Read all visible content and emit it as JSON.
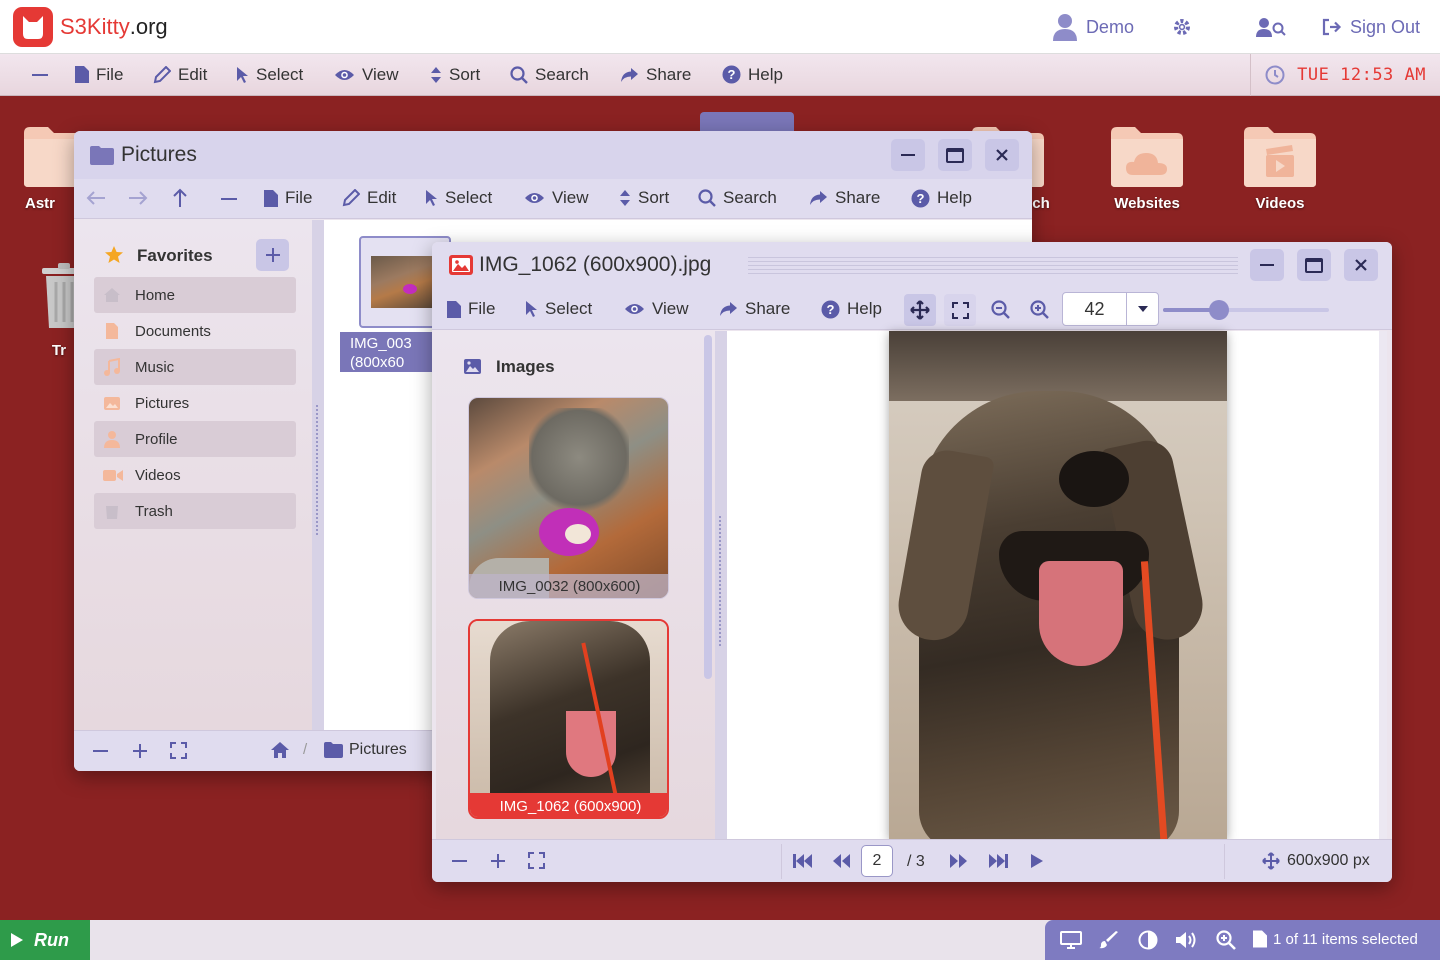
{
  "header": {
    "logo_s3": "S3",
    "logo_kitty": "Kitty",
    "logo_org": ".org",
    "user_label": "Demo",
    "signout_label": "Sign Out"
  },
  "menubar": {
    "items": [
      "File",
      "Edit",
      "Select",
      "View",
      "Sort",
      "Search",
      "Share",
      "Help"
    ],
    "clock": "TUE 12:53 AM"
  },
  "desktop": {
    "icons": [
      {
        "label": "Astr",
        "icon": "folder-icon"
      },
      {
        "label": "Tr",
        "icon": "trash-icon"
      },
      {
        "label": "ch",
        "icon": "folder-icon"
      },
      {
        "label": "Websites",
        "icon": "cloud-folder-icon"
      },
      {
        "label": "Videos",
        "icon": "video-folder-icon"
      }
    ]
  },
  "pictures_window": {
    "title": "Pictures",
    "toolbar": [
      "File",
      "Edit",
      "Select",
      "View",
      "Sort",
      "Search",
      "Share",
      "Help"
    ],
    "favorites_label": "Favorites",
    "sidebar": [
      {
        "label": "Home",
        "icon": "home-icon"
      },
      {
        "label": "Documents",
        "icon": "document-icon"
      },
      {
        "label": "Music",
        "icon": "music-icon"
      },
      {
        "label": "Pictures",
        "icon": "image-icon"
      },
      {
        "label": "Profile",
        "icon": "user-icon"
      },
      {
        "label": "Videos",
        "icon": "video-icon"
      },
      {
        "label": "Trash",
        "icon": "trash-icon"
      }
    ],
    "file_item": {
      "line1": "IMG_003",
      "line2": "(800x60"
    },
    "breadcrumb_folder": "Pictures"
  },
  "viewer_window": {
    "title": "IMG_1062 (600x900).jpg",
    "toolbar": [
      "File",
      "Select",
      "View",
      "Share",
      "Help"
    ],
    "zoom_value": "42",
    "zoom_slider_fraction": 0.34,
    "panel_title": "Images",
    "thumbnails": [
      {
        "label": "IMG_0032 (800x600)",
        "selected": false
      },
      {
        "label": "IMG_1062 (600x900)",
        "selected": true
      }
    ],
    "page_current": "2",
    "page_total": "/ 3",
    "image_size": "600x900 px"
  },
  "taskbar": {
    "run_label": "Run",
    "status_text": "1 of 11 items selected"
  },
  "colors": {
    "desktop_bg": "#8b2222",
    "accent": "#e53935",
    "toolbar_icon": "#5b5ba8",
    "run_green": "#2e9b4a"
  }
}
